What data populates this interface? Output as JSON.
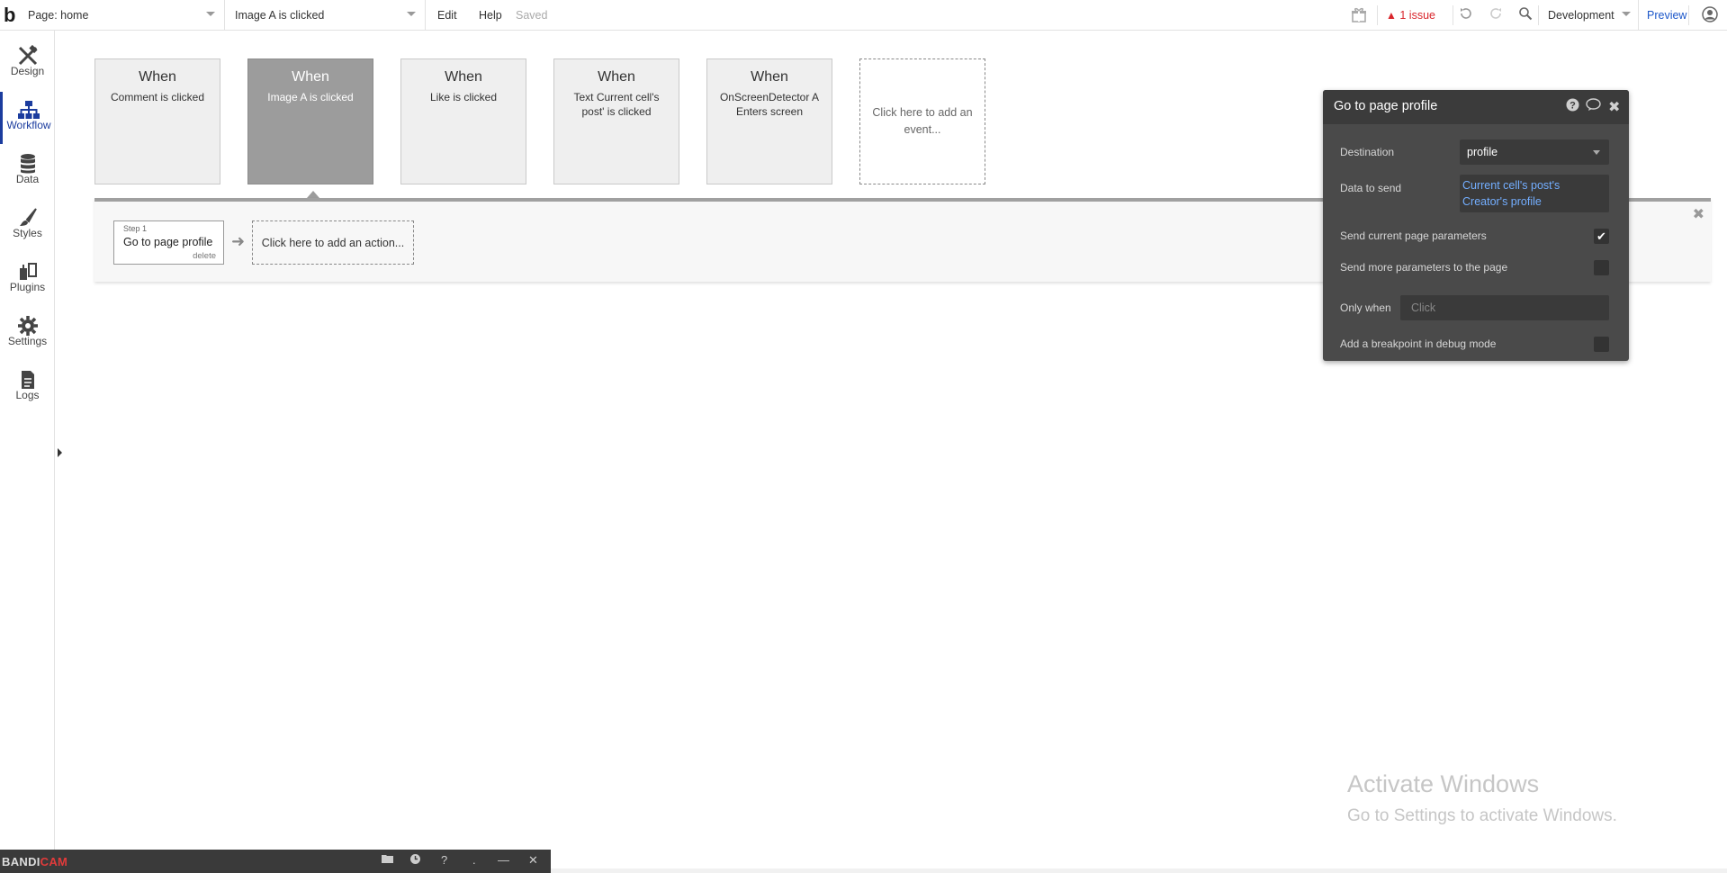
{
  "topbar": {
    "logo": "b",
    "page_selector": "Page: home",
    "event_selector": "Image A is clicked",
    "menu": [
      "Edit",
      "Help"
    ],
    "status": "Saved",
    "issue_label": "1 issue",
    "env_selector": "Development",
    "preview_label": "Preview"
  },
  "sidebar": {
    "items": [
      {
        "label": "Design",
        "icon": "design-icon"
      },
      {
        "label": "Workflow",
        "icon": "workflow-icon"
      },
      {
        "label": "Data",
        "icon": "database-icon"
      },
      {
        "label": "Styles",
        "icon": "brush-icon"
      },
      {
        "label": "Plugins",
        "icon": "plug-icon"
      },
      {
        "label": "Settings",
        "icon": "gear-icon"
      },
      {
        "label": "Logs",
        "icon": "document-icon"
      }
    ],
    "active": "Workflow"
  },
  "events": [
    {
      "when": "When",
      "text": "Comment is clicked"
    },
    {
      "when": "When",
      "text": "Image A is clicked"
    },
    {
      "when": "When",
      "text": "Like is clicked"
    },
    {
      "when": "When",
      "text": "Text Current cell's post' is clicked"
    },
    {
      "when": "When",
      "text": "OnScreenDetector A Enters screen"
    }
  ],
  "add_event_label": "Click here to add an event...",
  "actions": {
    "step_label": "Step 1",
    "step_name": "Go to page profile",
    "step_delete": "delete",
    "add_action_label": "Click here to add an action..."
  },
  "property_editor": {
    "title": "Go to page profile",
    "destination_label": "Destination",
    "destination_value": "profile",
    "data_label": "Data to send",
    "data_value_line1": "Current cell's post's",
    "data_value_line2": "Creator's profile",
    "send_current_label": "Send current page parameters",
    "send_current_checked": true,
    "send_more_label": "Send more parameters to the page",
    "send_more_checked": false,
    "only_when_label": "Only when",
    "only_when_placeholder": "Click",
    "breakpoint_label": "Add a breakpoint in debug mode",
    "breakpoint_checked": false
  },
  "watermark": {
    "title": "Activate Windows",
    "subtitle": "Go to Settings to activate Windows."
  },
  "bandicam": {
    "brand_a": "BANDI",
    "brand_b": "CAM"
  }
}
